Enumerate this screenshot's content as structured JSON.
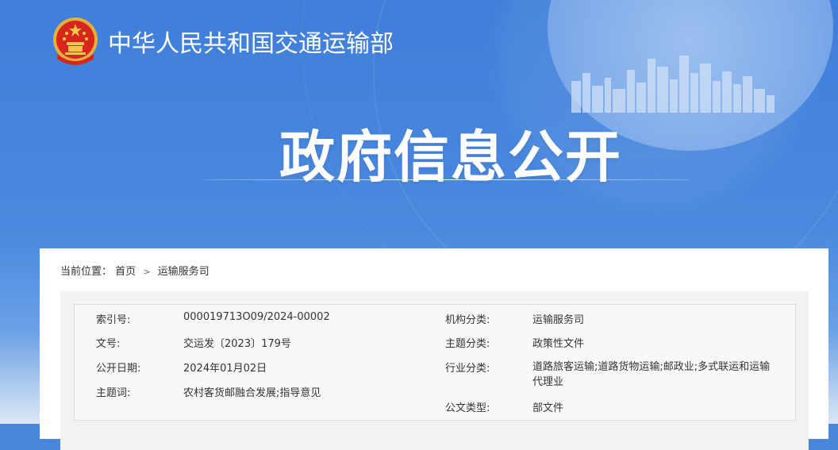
{
  "header": {
    "site_title": "中华人民共和国交通运输部",
    "banner_title": "政府信息公开"
  },
  "breadcrumb": {
    "label": "当前位置：",
    "items": [
      "首页",
      "运输服务司"
    ],
    "separator": ">"
  },
  "info": {
    "index_no": {
      "label": "索引号:",
      "value": "000019713O09/2024-00002"
    },
    "doc_no": {
      "label": "文号:",
      "value": "交运发〔2023〕179号"
    },
    "pub_date": {
      "label": "公开日期:",
      "value": "2024年01月02日"
    },
    "keywords": {
      "label": "主题词:",
      "value": "农村客货邮融合发展;指导意见"
    },
    "org_category": {
      "label": "机构分类:",
      "value": "运输服务司"
    },
    "topic_category": {
      "label": "主题分类:",
      "value": "政策性文件"
    },
    "industry_category": {
      "label": "行业分类:",
      "value": "道路旅客运输;道路货物运输;邮政业;多式联运和运输代理业"
    },
    "doc_type": {
      "label": "公文类型:",
      "value": "部文件"
    }
  },
  "colors": {
    "banner_blue": "#4a86dc",
    "panel_white": "#ffffff",
    "emblem_red": "#d7261e",
    "emblem_gold": "#f4c64a"
  }
}
